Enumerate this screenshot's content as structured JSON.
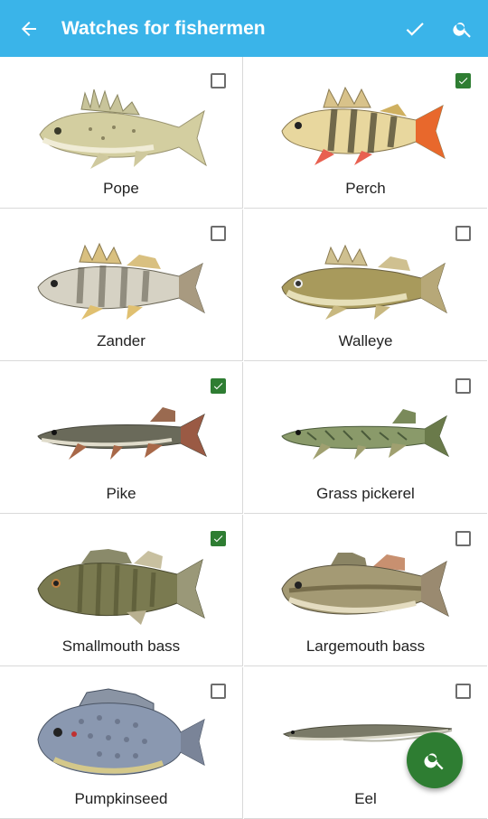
{
  "appbar": {
    "title": "Watches for fishermen",
    "back_icon": "arrow-back-icon",
    "confirm_icon": "check-icon",
    "search_icon": "search-icon",
    "color": "#3ab4e9"
  },
  "fish": [
    {
      "name": "Pope",
      "checked": false
    },
    {
      "name": "Perch",
      "checked": true
    },
    {
      "name": "Zander",
      "checked": false
    },
    {
      "name": "Walleye",
      "checked": false
    },
    {
      "name": "Pike",
      "checked": true
    },
    {
      "name": "Grass pickerel",
      "checked": false
    },
    {
      "name": "Smallmouth bass",
      "checked": true
    },
    {
      "name": "Largemouth bass",
      "checked": false
    },
    {
      "name": "Pumpkinseed",
      "checked": false
    },
    {
      "name": "Eel",
      "checked": false
    }
  ],
  "fab": {
    "icon": "search-icon",
    "color": "#2e7d32"
  },
  "colors": {
    "checkbox_checked": "#2e7d32",
    "divider": "#d9d9d9"
  }
}
